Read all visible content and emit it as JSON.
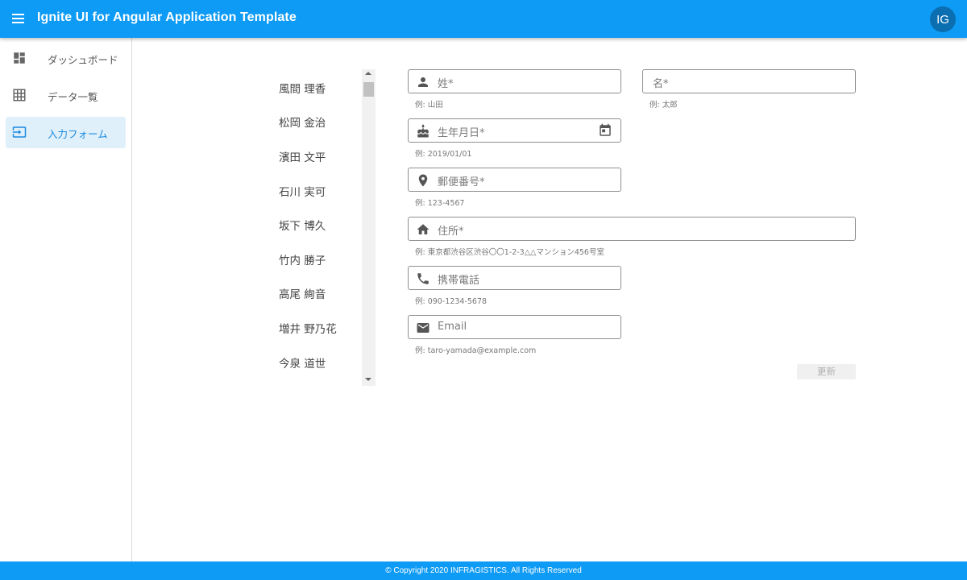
{
  "header": {
    "title": "Ignite UI for Angular Application Template",
    "avatar_initials": "IG",
    "brand_color": "#0e9bf5"
  },
  "sidebar": {
    "items": [
      {
        "label": "ダッシュボード",
        "icon": "dashboard-icon",
        "active": false
      },
      {
        "label": "データ一覧",
        "icon": "grid-icon",
        "active": false
      },
      {
        "label": "入力フォーム",
        "icon": "input-icon",
        "active": true
      }
    ]
  },
  "names": [
    "風間 理香",
    "松岡 金治",
    "濱田 文平",
    "石川 実可",
    "坂下 博久",
    "竹内 勝子",
    "高尾 絢音",
    "増井 野乃花",
    "今泉 道世"
  ],
  "form": {
    "last_name": {
      "label": "姓",
      "required": "*",
      "hint": "例: 山田",
      "icon": "person-icon"
    },
    "first_name": {
      "label": "名",
      "required": "*",
      "hint": "例: 太郎"
    },
    "birthday": {
      "label": "生年月日",
      "required": "*",
      "hint": "例: 2019/01/01",
      "icon": "cake-icon",
      "trailing_icon": "calendar-icon"
    },
    "postal": {
      "label": "郵便番号",
      "required": "*",
      "hint": "例: 123-4567",
      "icon": "location-pin-icon"
    },
    "address": {
      "label": "住所",
      "required": "*",
      "hint": "例: 東京都渋谷区渋谷〇〇1-2-3△△マンション456号室",
      "icon": "home-icon"
    },
    "mobile": {
      "label": "携帯電話",
      "required": "",
      "hint": "例: 090-1234-5678",
      "icon": "phone-icon"
    },
    "email": {
      "label": "Email",
      "required": "",
      "hint": "例: taro-yamada@example.com",
      "icon": "mail-icon"
    },
    "update_label": "更新"
  },
  "footer": {
    "copyright": "© Copyright 2020 INFRAGISTICS. All Rights Reserved"
  }
}
